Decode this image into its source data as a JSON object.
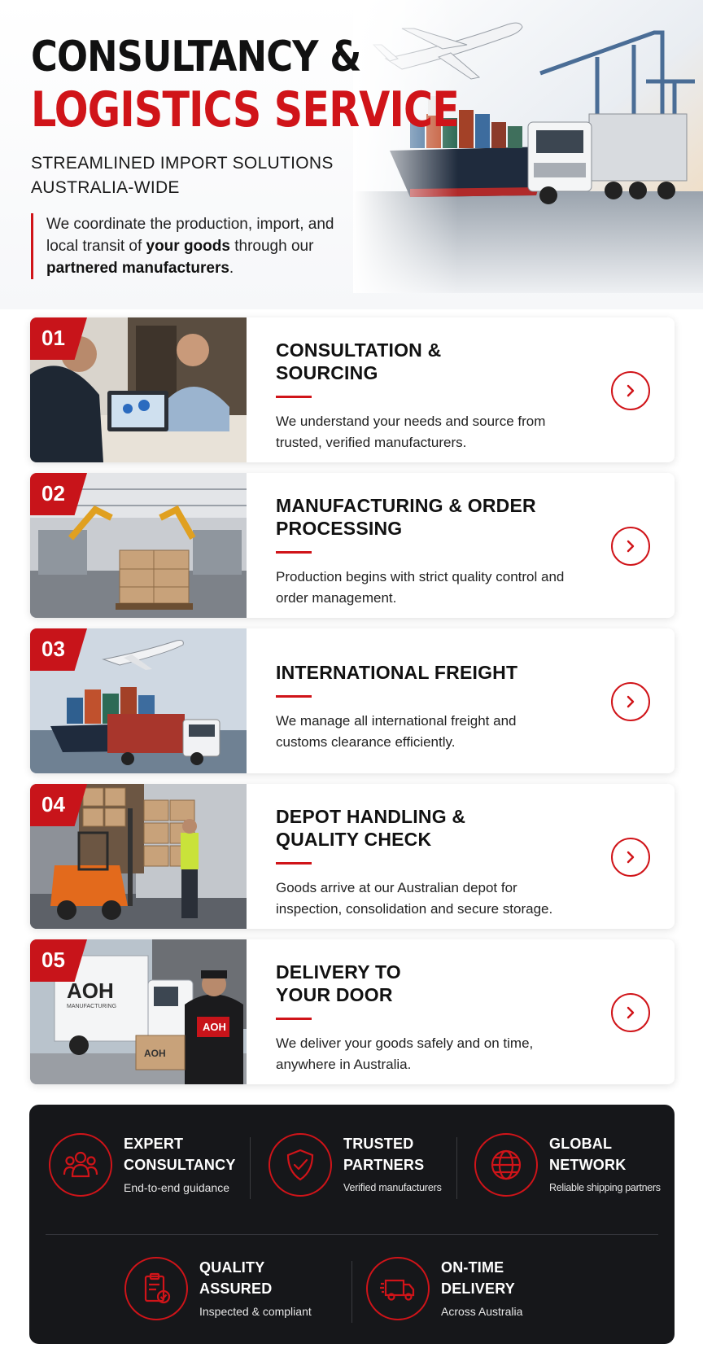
{
  "hero": {
    "title_line1": "CONSULTANCY &",
    "title_line2": "LOGISTICS SERVICE",
    "subtitle": "STREAMLINED IMPORT SOLUTIONS AUSTRALIA-WIDE",
    "intro_part1": "We coordinate the production, import, and local transit of ",
    "intro_bold1": "your goods",
    "intro_part2": " through our ",
    "intro_bold2": "partnered manufacturers",
    "intro_part3": "."
  },
  "steps": [
    {
      "number": "01",
      "title": "CONSULTATION & SOURCING",
      "description": "We understand your needs and source from trusted, verified manufacturers.",
      "photo_icon": "consultation-photo"
    },
    {
      "number": "02",
      "title": "MANUFACTURING & ORDER PROCESSING",
      "description": "Production begins with strict quality control and order management.",
      "photo_icon": "factory-photo"
    },
    {
      "number": "03",
      "title": "INTERNATIONAL FREIGHT",
      "description": "We manage all international freight and customs clearance efficiently.",
      "photo_icon": "freight-photo"
    },
    {
      "number": "04",
      "title": "DEPOT HANDLING & QUALITY CHECK",
      "description": "Goods arrive at our Australian depot for inspection, consolidation and secure storage.",
      "photo_icon": "depot-photo"
    },
    {
      "number": "05",
      "title": "DELIVERY TO YOUR DOOR",
      "description": "We deliver your goods safely and on time, anywhere in Australia.",
      "photo_icon": "delivery-photo"
    }
  ],
  "photo_text": {
    "truck_brand": "AOH",
    "truck_brand_sub": "MANUFACTURING",
    "shirt_brand": "AOH",
    "box_brand": "AOH"
  },
  "features": [
    {
      "title_line1": "EXPERT",
      "title_line2": "CONSULTANCY",
      "subtitle": "End-to-end guidance",
      "icon": "people-icon"
    },
    {
      "title_line1": "TRUSTED",
      "title_line2": "PARTNERS",
      "subtitle": "Verified manufacturers",
      "icon": "shield-check-icon"
    },
    {
      "title_line1": "GLOBAL",
      "title_line2": "NETWORK",
      "subtitle": "Reliable shipping partners",
      "icon": "globe-icon"
    },
    {
      "title_line1": "QUALITY",
      "title_line2": "ASSURED",
      "subtitle": "Inspected & compliant",
      "icon": "clipboard-check-icon"
    },
    {
      "title_line1": "ON-TIME",
      "title_line2": "DELIVERY",
      "subtitle": "Across Australia",
      "icon": "truck-icon"
    }
  ],
  "colors": {
    "accent": "#d01419",
    "dark_panel": "#16171a",
    "text": "#111111"
  }
}
